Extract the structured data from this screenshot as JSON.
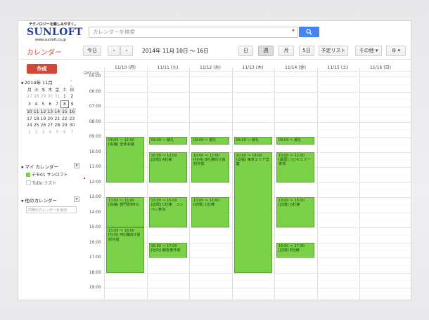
{
  "brand": {
    "tagline": "テクノロジーを親しみやすく。",
    "name": "SUNLOFT",
    "url": "www.sunloft.co.jp"
  },
  "search": {
    "placeholder": "カレンダーを検索"
  },
  "toolbar": {
    "title": "カレンダー",
    "today": "今日",
    "prev": "‹",
    "next": "›",
    "range": "2014年 11月 10日 〜 16日",
    "views": [
      "日",
      "週",
      "月",
      "5日",
      "予定リスト"
    ],
    "more": "その他 ▾",
    "settings": "⚙ ▾"
  },
  "left": {
    "create": "作成",
    "month": "2014年 11月",
    "weekdays": [
      "月",
      "火",
      "水",
      "木",
      "金",
      "土",
      "日"
    ],
    "weeks": [
      [
        "27",
        "28",
        "29",
        "30",
        "31",
        "1",
        "2"
      ],
      [
        "3",
        "4",
        "5",
        "6",
        "7",
        "8",
        "9"
      ],
      [
        "10",
        "11",
        "12",
        "13",
        "14",
        "15",
        "16"
      ],
      [
        "17",
        "18",
        "19",
        "20",
        "21",
        "22",
        "23"
      ],
      [
        "24",
        "25",
        "26",
        "27",
        "28",
        "29",
        "30"
      ],
      [
        "1",
        "2",
        "3",
        "4",
        "5",
        "6",
        "7"
      ]
    ],
    "my_calendars": "マイ カレンダー",
    "my_items": [
      {
        "label": "デモ01 サンロフト",
        "color": "#7bd148"
      },
      {
        "label": "ToDo リスト",
        "color": "#ffffff"
      }
    ],
    "other_calendars": "他のカレンダー",
    "add_placeholder": "同僚のカレンダーを追加"
  },
  "grid": {
    "timezone": "GMT+09",
    "days": [
      "11/10 (月)",
      "11/11 (火)",
      "11/12 (水)",
      "11/13 (木)",
      "11/14 (金)",
      "11/15 (土)",
      "11/16 (日)"
    ],
    "hours": [
      "05:00",
      "06:00",
      "07:00",
      "08:00",
      "09:00",
      "10:00",
      "11:00",
      "12:00",
      "13:00",
      "14:00",
      "15:00",
      "16:00",
      "17:00",
      "18:00",
      "19:00"
    ]
  },
  "events": [
    {
      "day": 0,
      "start": 9.0,
      "end": 12.0,
      "time": "09:00 ～ 12:00",
      "title": "[会議] 全体会議"
    },
    {
      "day": 0,
      "start": 13.0,
      "end": 15.0,
      "time": "13:00 ～ 15:00",
      "title": "[会議] 部門別MTG"
    },
    {
      "day": 0,
      "start": 15.0,
      "end": 18.0,
      "time": "15:00 ～ 18:00",
      "title": "[社内] A社様向け資料作成"
    },
    {
      "day": 1,
      "start": 9.0,
      "end": 9.5,
      "time": "09:00 ～ 朝礼",
      "title": ""
    },
    {
      "day": 1,
      "start": 10.0,
      "end": 12.0,
      "time": "10:00 ～ 12:00",
      "title": "[訪問] A社様"
    },
    {
      "day": 1,
      "start": 13.0,
      "end": 15.0,
      "time": "13:00 ～ 15:00",
      "title": "[訪問] C社様　コンペに参加"
    },
    {
      "day": 1,
      "start": 16.0,
      "end": 17.0,
      "time": "16:00 ～ 17:00",
      "title": "[社内] 報告書作成"
    },
    {
      "day": 2,
      "start": 9.0,
      "end": 9.5,
      "time": "09:00 ～ 朝礼",
      "title": ""
    },
    {
      "day": 2,
      "start": 10.0,
      "end": 12.0,
      "time": "10:00 ～ 12:00",
      "title": "[社内] B社様向け資料作成"
    },
    {
      "day": 2,
      "start": 13.0,
      "end": 15.0,
      "time": "13:00 ～ 15:00",
      "title": "[訪問] C社様"
    },
    {
      "day": 3,
      "start": 9.0,
      "end": 9.5,
      "time": "09:00 ～ 朝礼",
      "title": ""
    },
    {
      "day": 3,
      "start": 10.0,
      "end": 18.0,
      "time": "10:00 ～ 18:00",
      "title": "[出張] 東京エリア営業"
    },
    {
      "day": 4,
      "start": 9.0,
      "end": 9.5,
      "time": "09:00 ～ 朝礼",
      "title": ""
    },
    {
      "day": 4,
      "start": 10.0,
      "end": 12.0,
      "time": "10:00 ～ 12:00",
      "title": "[講習] ○○セミナー参加"
    },
    {
      "day": 4,
      "start": 13.0,
      "end": 15.0,
      "time": "13:00 ～ 15:00",
      "title": "[訪問] D社様"
    },
    {
      "day": 4,
      "start": 16.0,
      "end": 17.0,
      "time": "16:00 ～ 17:00",
      "title": "[訪問] E社様"
    }
  ]
}
